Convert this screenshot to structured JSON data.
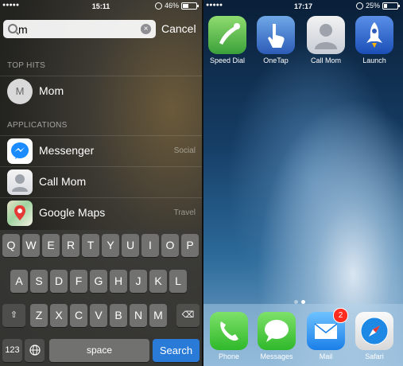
{
  "left": {
    "status": {
      "time": "15:11",
      "battery": "46%",
      "battery_level": 0.46,
      "signal": "●●●●●"
    },
    "search": {
      "value": "m",
      "cancel_label": "Cancel"
    },
    "top_hits": {
      "header": "TOP HITS",
      "items": [
        {
          "label": "Mom",
          "avatar": "M"
        }
      ]
    },
    "applications": {
      "header": "APPLICATIONS",
      "items": [
        {
          "label": "Messenger",
          "category": "Social",
          "icon": "messenger-icon"
        },
        {
          "label": "Call Mom",
          "category": "",
          "icon": "contact-icon"
        },
        {
          "label": "Google Maps",
          "category": "Travel",
          "icon": "maps-icon"
        }
      ]
    },
    "keyboard": {
      "row1": [
        "Q",
        "W",
        "E",
        "R",
        "T",
        "Y",
        "U",
        "I",
        "O",
        "P"
      ],
      "row2": [
        "A",
        "S",
        "D",
        "F",
        "G",
        "H",
        "J",
        "K",
        "L"
      ],
      "row3": [
        "Z",
        "X",
        "C",
        "V",
        "B",
        "N",
        "M"
      ],
      "numbers_label": "123",
      "space_label": "space",
      "search_label": "Search"
    }
  },
  "right": {
    "status": {
      "time": "17:17",
      "battery": "25%",
      "battery_level": 0.25,
      "signal": "●●●●●"
    },
    "apps": [
      {
        "label": "Speed Dial",
        "icon": "speed-dial-icon"
      },
      {
        "label": "OneTap",
        "icon": "onetap-icon"
      },
      {
        "label": "Call Mom",
        "icon": "contact-icon"
      },
      {
        "label": "Launch",
        "icon": "rocket-icon"
      }
    ],
    "dock": [
      {
        "label": "Phone",
        "icon": "phone-icon"
      },
      {
        "label": "Messages",
        "icon": "messages-icon"
      },
      {
        "label": "Mail",
        "icon": "mail-icon",
        "badge": "2"
      },
      {
        "label": "Safari",
        "icon": "safari-icon"
      }
    ]
  }
}
